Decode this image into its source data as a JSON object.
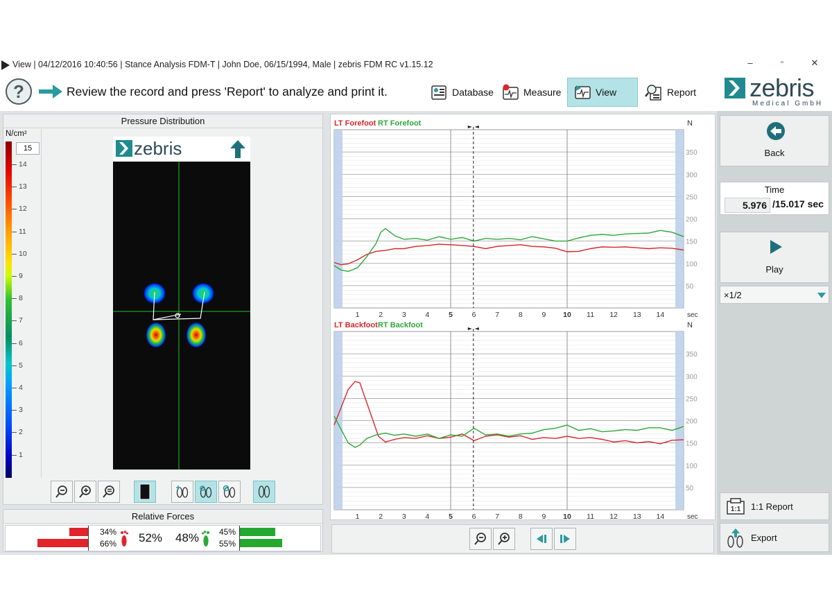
{
  "window": {
    "title": "View | 04/12/2016 10:40:56 | Stance Analysis FDM-T | John Doe, 06/15/1994, Male | zebris FDM RC v1.15.12",
    "controls": [
      "–",
      "▫",
      "✕"
    ]
  },
  "header": {
    "help_glyph": "?",
    "instruction": "Review the record and press 'Report' to analyze and print it.",
    "nav": [
      {
        "label": "Database",
        "icon": "database-icon"
      },
      {
        "label": "Measure",
        "icon": "measure-icon"
      },
      {
        "label": "View",
        "icon": "view-icon",
        "active": true
      },
      {
        "label": "Report",
        "icon": "report-icon"
      }
    ],
    "logo": {
      "word": "zebris",
      "sub": "Medical GmbH"
    }
  },
  "pressure_panel": {
    "title": "Pressure Distribution",
    "unit": "N/cm²",
    "scale_max": "15",
    "scale_ticks": [
      "14",
      "13",
      "12",
      "11",
      "10",
      "9",
      "8",
      "7",
      "6",
      "5",
      "4",
      "3",
      "2",
      "1"
    ],
    "image_logo": "zebris"
  },
  "relative_forces": {
    "title": "Relative Forces",
    "left_top": "34%",
    "left_bottom": "66%",
    "left_total": "52%",
    "right_total": "48%",
    "right_top": "45%",
    "right_bottom": "55%",
    "left_top_value": 34,
    "left_bottom_value": 66,
    "right_top_value": 45,
    "right_bottom_value": 55
  },
  "charts": {
    "top": {
      "lt_label": "LT Forefoot",
      "rt_label": "RT Forefoot",
      "unit": "N",
      "xunit": "sec"
    },
    "bottom": {
      "lt_label": "LT Backfoot",
      "rt_label": "RT Backfoot",
      "unit": "N",
      "xunit": "sec"
    }
  },
  "chart_data": [
    {
      "type": "line",
      "title": "",
      "xlabel": "sec",
      "ylabel": "N",
      "xlim": [
        0,
        15
      ],
      "ylim": [
        0,
        400
      ],
      "x_ticks": [
        "1",
        "2",
        "3",
        "4",
        "5",
        "6",
        "7",
        "8",
        "9",
        "10",
        "11",
        "12",
        "13",
        "14"
      ],
      "y_ticks": [
        "50",
        "100",
        "150",
        "200",
        "250",
        "300",
        "350"
      ],
      "cursor_time": 5.976,
      "series": [
        {
          "name": "LT Forefoot",
          "color": "#d9262b",
          "x": [
            0,
            0.3,
            0.6,
            1.0,
            1.4,
            1.8,
            2.2,
            2.6,
            3.0,
            3.5,
            4.0,
            4.5,
            5.0,
            5.5,
            6.0,
            6.5,
            7.0,
            7.5,
            8.0,
            8.5,
            9.0,
            9.5,
            10.0,
            10.5,
            11.0,
            11.5,
            12.0,
            12.5,
            13.0,
            13.5,
            14.0,
            14.5,
            15.0
          ],
          "y": [
            102,
            97,
            99,
            108,
            120,
            127,
            129,
            133,
            133,
            138,
            140,
            143,
            142,
            140,
            138,
            133,
            138,
            140,
            142,
            138,
            137,
            134,
            126,
            127,
            133,
            137,
            136,
            137,
            135,
            133,
            135,
            134,
            130
          ]
        },
        {
          "name": "RT Forefoot",
          "color": "#2da838",
          "x": [
            0,
            0.3,
            0.6,
            1.0,
            1.4,
            1.8,
            2.0,
            2.2,
            2.6,
            3.0,
            3.5,
            4.0,
            4.5,
            5.0,
            5.5,
            6.0,
            6.5,
            7.0,
            7.5,
            8.0,
            8.5,
            9.0,
            9.5,
            10.0,
            10.5,
            11.0,
            11.5,
            12.0,
            12.5,
            13.0,
            13.5,
            14.0,
            14.5,
            15.0
          ],
          "y": [
            95,
            85,
            82,
            90,
            115,
            145,
            170,
            178,
            162,
            154,
            156,
            152,
            160,
            154,
            158,
            150,
            156,
            154,
            156,
            153,
            160,
            155,
            150,
            150,
            157,
            163,
            165,
            163,
            166,
            167,
            168,
            174,
            170,
            160
          ]
        }
      ]
    },
    {
      "type": "line",
      "title": "",
      "xlabel": "sec",
      "ylabel": "N",
      "xlim": [
        0,
        15
      ],
      "ylim": [
        0,
        400
      ],
      "x_ticks": [
        "1",
        "2",
        "3",
        "4",
        "5",
        "6",
        "7",
        "8",
        "9",
        "10",
        "11",
        "12",
        "13",
        "14"
      ],
      "y_ticks": [
        "50",
        "100",
        "150",
        "200",
        "250",
        "300",
        "350"
      ],
      "cursor_time": 5.976,
      "series": [
        {
          "name": "LT Backfoot",
          "color": "#d9262b",
          "x": [
            0,
            0.3,
            0.6,
            0.9,
            1.1,
            1.3,
            1.6,
            1.9,
            2.2,
            2.6,
            3.0,
            3.5,
            4.0,
            4.5,
            5.0,
            5.5,
            6.0,
            6.5,
            7.0,
            7.5,
            8.0,
            8.5,
            9.0,
            9.5,
            10.0,
            10.5,
            11.0,
            11.5,
            12.0,
            12.5,
            13.0,
            13.5,
            14.0,
            14.5,
            15.0
          ],
          "y": [
            190,
            230,
            270,
            288,
            285,
            255,
            210,
            165,
            152,
            158,
            162,
            160,
            166,
            160,
            163,
            170,
            155,
            165,
            168,
            163,
            166,
            158,
            162,
            160,
            165,
            160,
            162,
            158,
            152,
            155,
            150,
            153,
            148,
            156,
            157
          ]
        },
        {
          "name": "RT Backfoot",
          "color": "#2da838",
          "x": [
            0,
            0.3,
            0.6,
            0.9,
            1.1,
            1.4,
            1.8,
            2.2,
            2.6,
            3.0,
            3.5,
            4.0,
            4.5,
            5.0,
            5.5,
            6.0,
            6.5,
            7.0,
            7.5,
            8.0,
            8.5,
            9.0,
            9.5,
            10.0,
            10.5,
            11.0,
            11.5,
            12.0,
            12.5,
            13.0,
            13.5,
            14.0,
            14.5,
            15.0
          ],
          "y": [
            210,
            180,
            150,
            140,
            145,
            160,
            168,
            172,
            167,
            170,
            165,
            170,
            160,
            168,
            165,
            183,
            168,
            170,
            165,
            170,
            172,
            180,
            183,
            190,
            178,
            182,
            175,
            177,
            180,
            178,
            184,
            184,
            178,
            187
          ]
        }
      ]
    }
  ],
  "chart_toolbar": {
    "zoom_out": "zoom-out",
    "zoom_in": "zoom-in"
  },
  "sidebar": {
    "back_label": "Back",
    "time_title": "Time",
    "time_current": "5.976",
    "time_total": "/15.017 sec",
    "play_label": "Play",
    "speed": "×1/2",
    "report_label": "1:1 Report",
    "export_label": "Export"
  },
  "colors": {
    "accent": "#1f8a8f",
    "active_bg": "#b3e3e6",
    "left_red": "#d9262b",
    "right_green": "#2da838"
  }
}
